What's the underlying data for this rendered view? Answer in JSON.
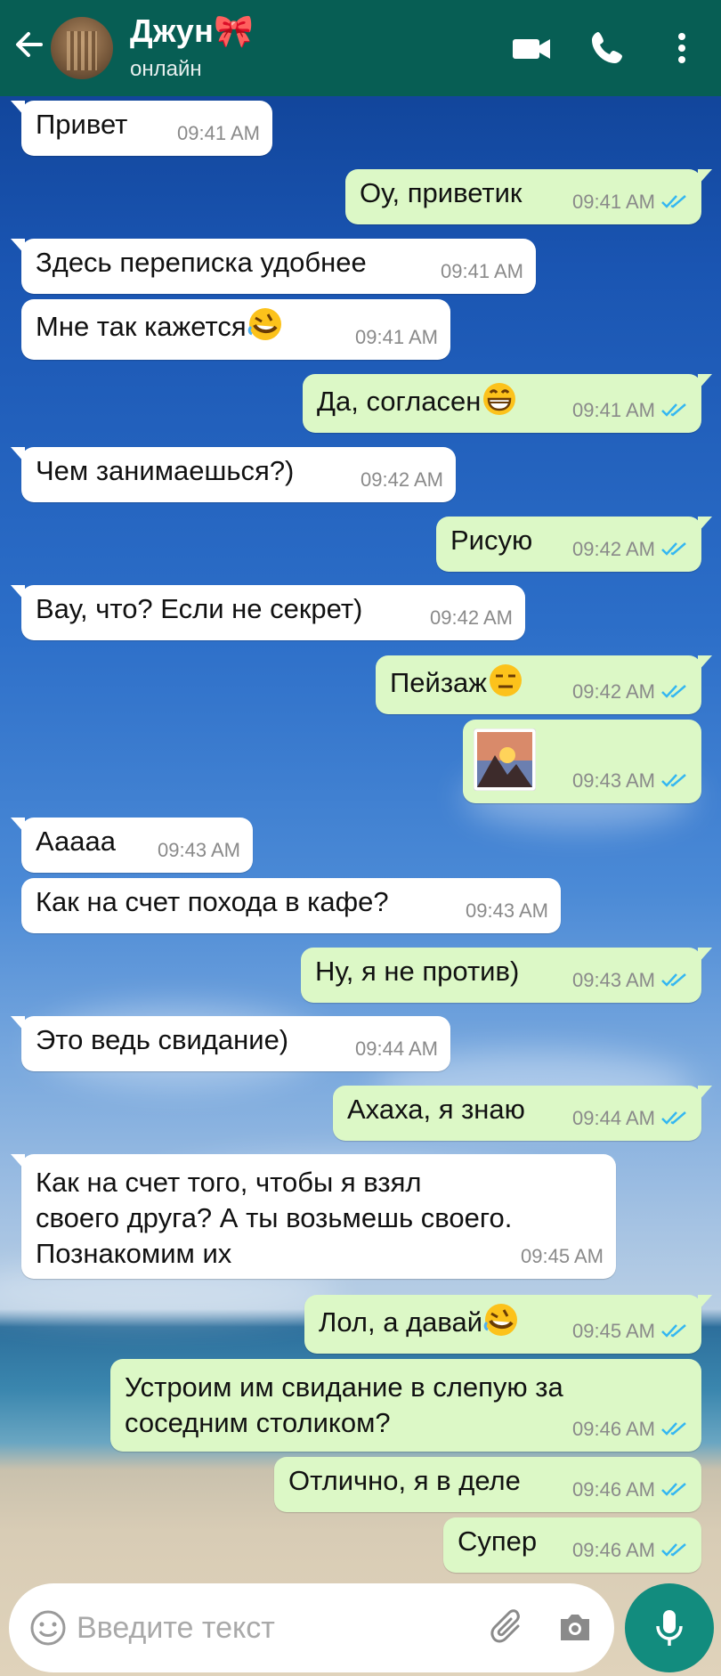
{
  "header": {
    "contact_name": "Джун🎀",
    "status": "онлайн"
  },
  "messages": [
    {
      "dir": "in",
      "text": "Привет",
      "time": "09:41 AM"
    },
    {
      "dir": "out",
      "text": "Оу, приветик",
      "time": "09:41 AM",
      "read": true
    },
    {
      "dir": "in",
      "text": "Здесь переписка удобнее",
      "time": "09:41 AM"
    },
    {
      "dir": "in",
      "text": "Мне так кажется",
      "emoji": "rofl",
      "time": "09:41 AM"
    },
    {
      "dir": "out",
      "text": "Да, согласен",
      "emoji": "grin",
      "time": "09:41 AM",
      "read": true
    },
    {
      "dir": "in",
      "text": "Чем занимаешься?)",
      "time": "09:42 AM"
    },
    {
      "dir": "out",
      "text": "Рисую",
      "time": "09:42 AM",
      "read": true
    },
    {
      "dir": "in",
      "text": "Вау, что? Если не секрет)",
      "time": "09:42 AM"
    },
    {
      "dir": "out",
      "text": "Пейзаж",
      "emoji": "expressionless",
      "time": "09:42 AM",
      "read": true
    },
    {
      "dir": "out",
      "text": "",
      "emoji": "sunrise-over-mountains",
      "time": "09:43 AM",
      "read": true
    },
    {
      "dir": "in",
      "text": "Ааааа",
      "time": "09:43 AM"
    },
    {
      "dir": "in",
      "text": "Как на счет похода в кафе?",
      "time": "09:43 AM"
    },
    {
      "dir": "out",
      "text": "Ну, я не против)",
      "time": "09:43 AM",
      "read": true
    },
    {
      "dir": "in",
      "text": "Это ведь свидание)",
      "time": "09:44 AM"
    },
    {
      "dir": "out",
      "text": "Ахаха, я знаю",
      "time": "09:44 AM",
      "read": true
    },
    {
      "dir": "in",
      "text": "Как на счет того, чтобы я взял\nсвоего друга? А ты возьмешь своего.\nПознакомим их",
      "time": "09:45 AM"
    },
    {
      "dir": "out",
      "text": "Лол, а давай",
      "emoji": "rofl",
      "time": "09:45 AM",
      "read": true
    },
    {
      "dir": "out",
      "text": "Устроим им свидание в слепую за\nсоседним столиком?",
      "time": "09:46 AM",
      "read": true
    },
    {
      "dir": "out",
      "text": "Отлично, я в деле",
      "time": "09:46 AM",
      "read": true
    },
    {
      "dir": "out",
      "text": "Супер",
      "time": "09:46 AM",
      "read": true
    }
  ],
  "composer": {
    "placeholder": "Введите текст",
    "value": ""
  },
  "colors": {
    "header": "#075e54",
    "incoming_bubble": "#ffffff",
    "outgoing_bubble": "#dcf8c6",
    "read_ticks": "#34b7f1",
    "mic_button": "#128c7e"
  }
}
